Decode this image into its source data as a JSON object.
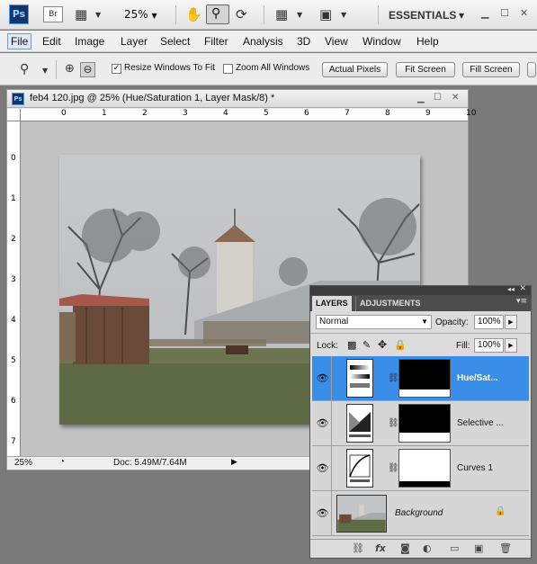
{
  "app": {
    "logo": "Ps",
    "bridge": "Br",
    "zoom": "25%",
    "workspace": "ESSENTIALS"
  },
  "menu": [
    "File",
    "Edit",
    "Image",
    "Layer",
    "Select",
    "Filter",
    "Analysis",
    "3D",
    "View",
    "Window",
    "Help"
  ],
  "options": {
    "resize_label": "Resize Windows To Fit",
    "resize_checked": true,
    "zoom_all_label": "Zoom All Windows",
    "zoom_all_checked": false,
    "btn_actual": "Actual Pixels",
    "btn_fit": "Fit Screen",
    "btn_fill": "Fill Screen"
  },
  "document": {
    "title": "feb4 120.jpg @ 25% (Hue/Saturation 1, Layer Mask/8) *",
    "zoom": "25%",
    "doc_info": "Doc: 5.49M/7.64M",
    "hruler": [
      "0",
      "1",
      "2",
      "3",
      "4",
      "5",
      "6",
      "7",
      "8",
      "9",
      "10"
    ],
    "vruler": [
      "0",
      "1",
      "2",
      "3",
      "4",
      "5",
      "6",
      "7"
    ]
  },
  "layers_panel": {
    "tab_layers": "LAYERS",
    "tab_adjustments": "ADJUSTMENTS",
    "blend_mode": "Normal",
    "opacity_label": "Opacity:",
    "opacity": "100%",
    "lock_label": "Lock:",
    "fill_label": "Fill:",
    "fill": "100%",
    "layers": [
      {
        "name": "Hue/Sat...",
        "selected": true
      },
      {
        "name": "Selective ...",
        "selected": false
      },
      {
        "name": "Curves 1",
        "selected": false
      },
      {
        "name": "Background",
        "selected": false
      }
    ]
  },
  "colors": {
    "selection": "#3b8ee8",
    "panel_header": "#3c3c3c"
  }
}
